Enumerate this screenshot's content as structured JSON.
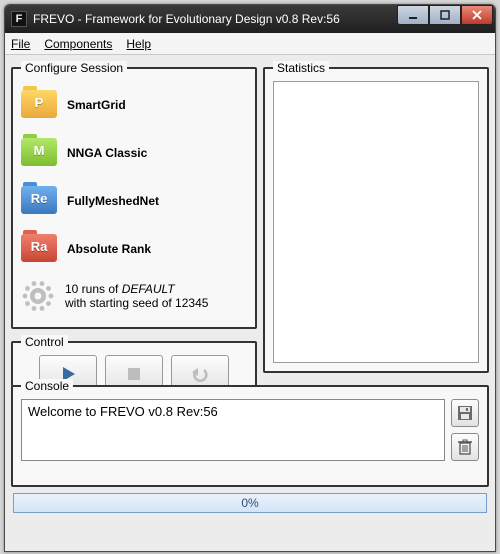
{
  "titlebar": {
    "app_letter": "F",
    "title": "FREVO - Framework for Evolutionary Design v0.8 Rev:56"
  },
  "menu": {
    "file": "File",
    "components": "Components",
    "help": "Help"
  },
  "configure": {
    "legend": "Configure Session",
    "items": [
      {
        "label": "SmartGrid",
        "color": "f-yellow",
        "letter": "P"
      },
      {
        "label": "NNGA Classic",
        "color": "f-green",
        "letter": "M"
      },
      {
        "label": "FullyMeshedNet",
        "color": "f-blue",
        "letter": "Re"
      },
      {
        "label": "Absolute Rank",
        "color": "f-red",
        "letter": "Ra"
      }
    ],
    "runs_line1_a": "10 runs of ",
    "runs_line1_b": "DEFAULT",
    "runs_line2": "with starting seed of 12345"
  },
  "statistics": {
    "legend": "Statistics"
  },
  "control": {
    "legend": "Control"
  },
  "console": {
    "legend": "Console",
    "text": "Welcome to FREVO v0.8 Rev:56"
  },
  "progress": {
    "label": "0%"
  }
}
